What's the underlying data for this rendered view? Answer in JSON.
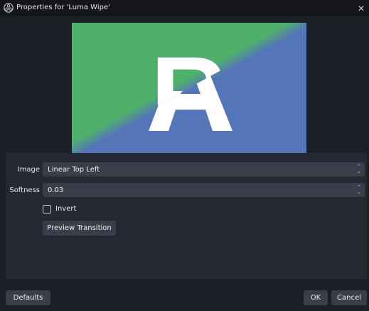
{
  "window": {
    "title": "Properties for 'Luma Wipe'",
    "close_glyph": "✕"
  },
  "preview": {
    "glyph": "R",
    "colors": {
      "green": "#4fb06c",
      "blue": "#5475b8",
      "glyph": "#ffffff"
    }
  },
  "form": {
    "image_label": "Image",
    "image_value": "Linear Top Left",
    "softness_label": "Softness",
    "softness_value": "0.03",
    "invert_label": "Invert",
    "invert_checked": false,
    "preview_transition_label": "Preview Transition"
  },
  "footer": {
    "defaults_label": "Defaults",
    "ok_label": "OK",
    "cancel_label": "Cancel"
  },
  "icons": {
    "app": "obs-logo-icon",
    "close": "close-icon",
    "dropdown": "chevron-updown-icon",
    "spin": "spin-arrows-icon"
  }
}
